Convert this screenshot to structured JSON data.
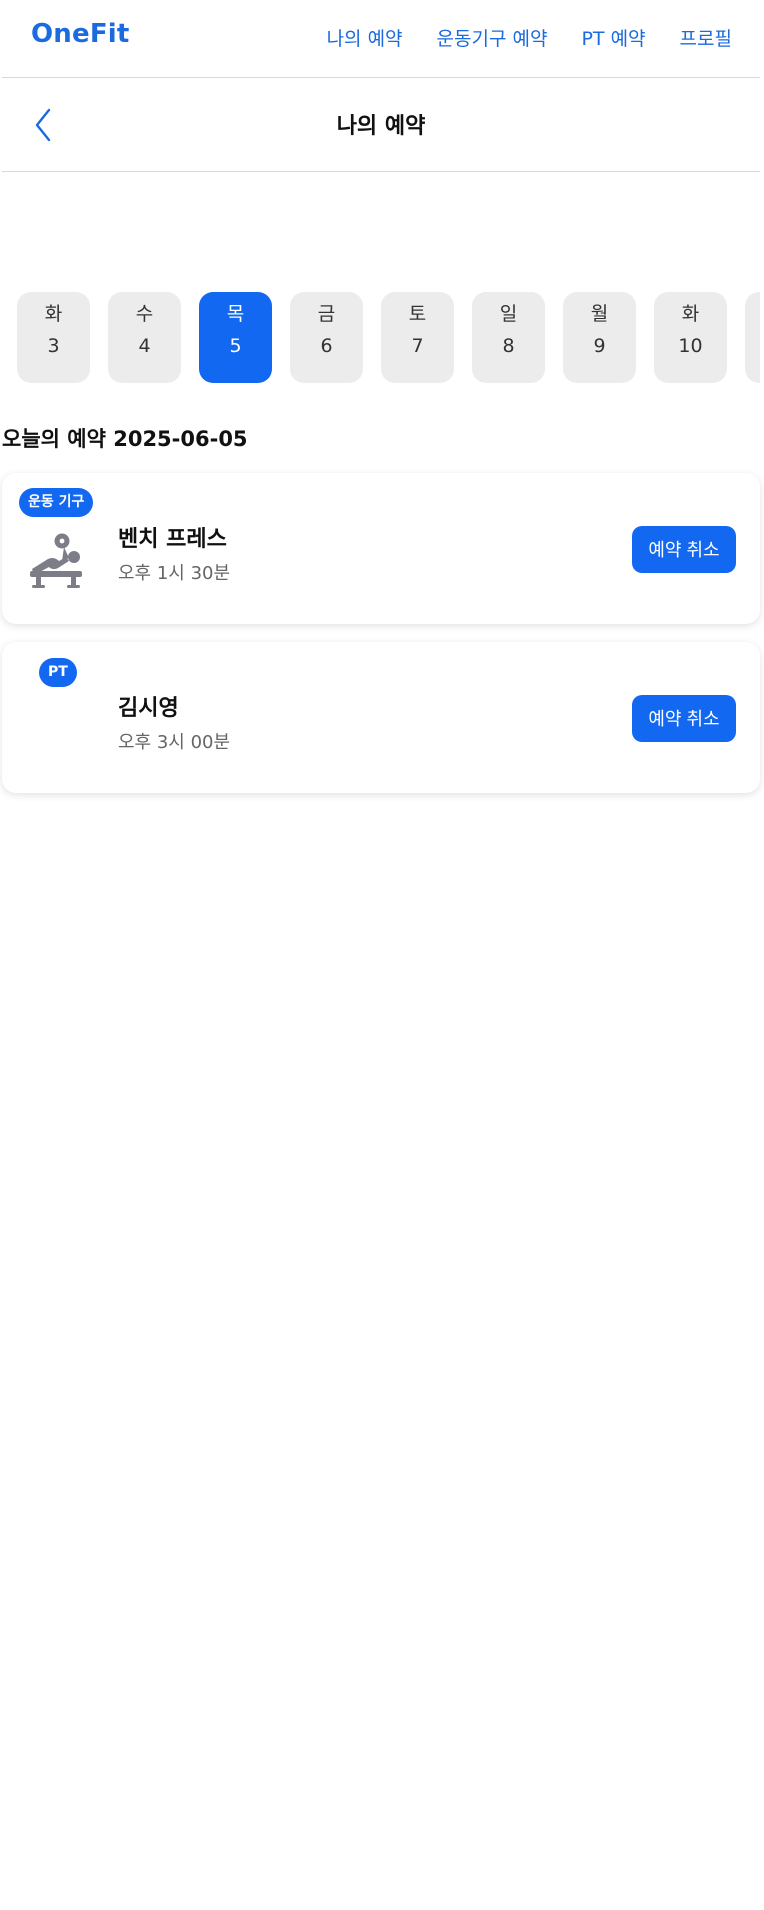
{
  "app": {
    "brand": "OneFit",
    "brand_color": "#1a6be0",
    "accent_color": "#1368f2"
  },
  "nav": {
    "items": [
      {
        "label": "나의 예약"
      },
      {
        "label": "운동기구 예약"
      },
      {
        "label": "PT 예약"
      },
      {
        "label": "프로필"
      }
    ]
  },
  "header": {
    "back_icon": "chevron-left-icon",
    "title": "나의 예약"
  },
  "dates": [
    {
      "dow": "화",
      "day": "3",
      "selected": false
    },
    {
      "dow": "수",
      "day": "4",
      "selected": false
    },
    {
      "dow": "목",
      "day": "5",
      "selected": true
    },
    {
      "dow": "금",
      "day": "6",
      "selected": false
    },
    {
      "dow": "토",
      "day": "7",
      "selected": false
    },
    {
      "dow": "일",
      "day": "8",
      "selected": false
    },
    {
      "dow": "월",
      "day": "9",
      "selected": false
    },
    {
      "dow": "화",
      "day": "10",
      "selected": false
    },
    {
      "dow": "",
      "day": "",
      "selected": false
    }
  ],
  "section": {
    "title": "오늘의 예약 2025-06-05"
  },
  "reservations": [
    {
      "badge": "운동 기구",
      "icon": "bench-press-icon",
      "title": "벤치 프레스",
      "time": "오후 1시 30분",
      "cancel_label": "예약 취소"
    },
    {
      "badge": "PT",
      "title": "김시영",
      "time": "오후 3시 00분",
      "cancel_label": "예약 취소"
    }
  ]
}
